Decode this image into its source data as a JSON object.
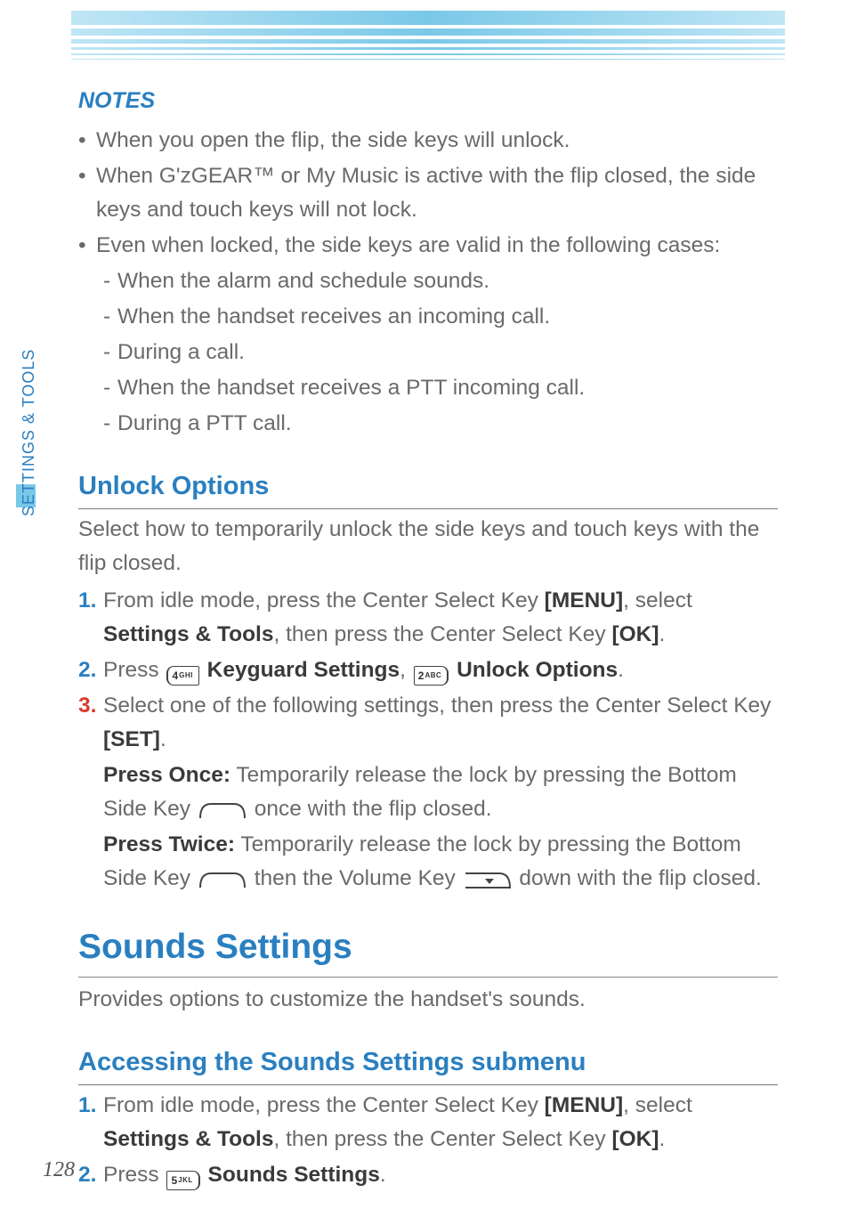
{
  "sideLabel": "SETTINGS & TOOLS",
  "pageNumber": "128",
  "notes": {
    "title": "NOTES",
    "bullets": [
      "When you open the flip, the side keys will unlock.",
      "When G'zGEAR™ or My Music is active with the flip closed, the side keys and touch keys will not lock.",
      "Even when locked, the side keys are valid in the following cases:"
    ],
    "subs": [
      "When the alarm and schedule sounds.",
      "When the handset receives an incoming call.",
      "During a call.",
      "When the handset receives a PTT incoming call.",
      "During a PTT call."
    ]
  },
  "unlock": {
    "title": "Unlock Options",
    "lead": "Select how to temporarily unlock the side keys and touch keys with the flip closed.",
    "step1": {
      "num": "1.",
      "a": " From idle mode, press the Center Select Key ",
      "menu": "[MENU]",
      "b": ", select ",
      "settings": "Settings & Tools",
      "c": ", then press the Center Select Key ",
      "ok": "[OK]",
      "d": "."
    },
    "step2": {
      "num": "2.",
      "a": " Press ",
      "key4": "4",
      "key4sub": "GHI",
      "kg": " Keyguard Settings",
      "comma": ", ",
      "key2": "2",
      "key2sub": "ABC",
      "uo": " Unlock Options",
      "d": "."
    },
    "step3": {
      "num": "3.",
      "a": " Select one of the following settings, then press the Center Select Key ",
      "set": "[SET]",
      "d": "."
    },
    "pressOnce": {
      "label": "Press Once:",
      "a": " Temporarily release the lock by pressing the Bottom Side Key ",
      "b": " once with the flip closed."
    },
    "pressTwice": {
      "label": "Press Twice:",
      "a": " Temporarily release the lock by pressing the Bottom Side Key ",
      "b": " then the Volume Key ",
      "c": " down with the flip closed."
    }
  },
  "sounds": {
    "title": "Sounds Settings",
    "lead": "Provides options to customize the handset's sounds.",
    "subTitle": "Accessing the Sounds Settings submenu",
    "step1": {
      "num": "1.",
      "a": " From idle mode, press the Center Select Key ",
      "menu": "[MENU]",
      "b": ", select ",
      "settings": "Settings & Tools",
      "c": ", then press the Center Select Key ",
      "ok": "[OK]",
      "d": "."
    },
    "step2": {
      "num": "2.",
      "a": " Press ",
      "key5": "5",
      "key5sub": "JKL",
      "ss": " Sounds Settings",
      "d": "."
    }
  }
}
